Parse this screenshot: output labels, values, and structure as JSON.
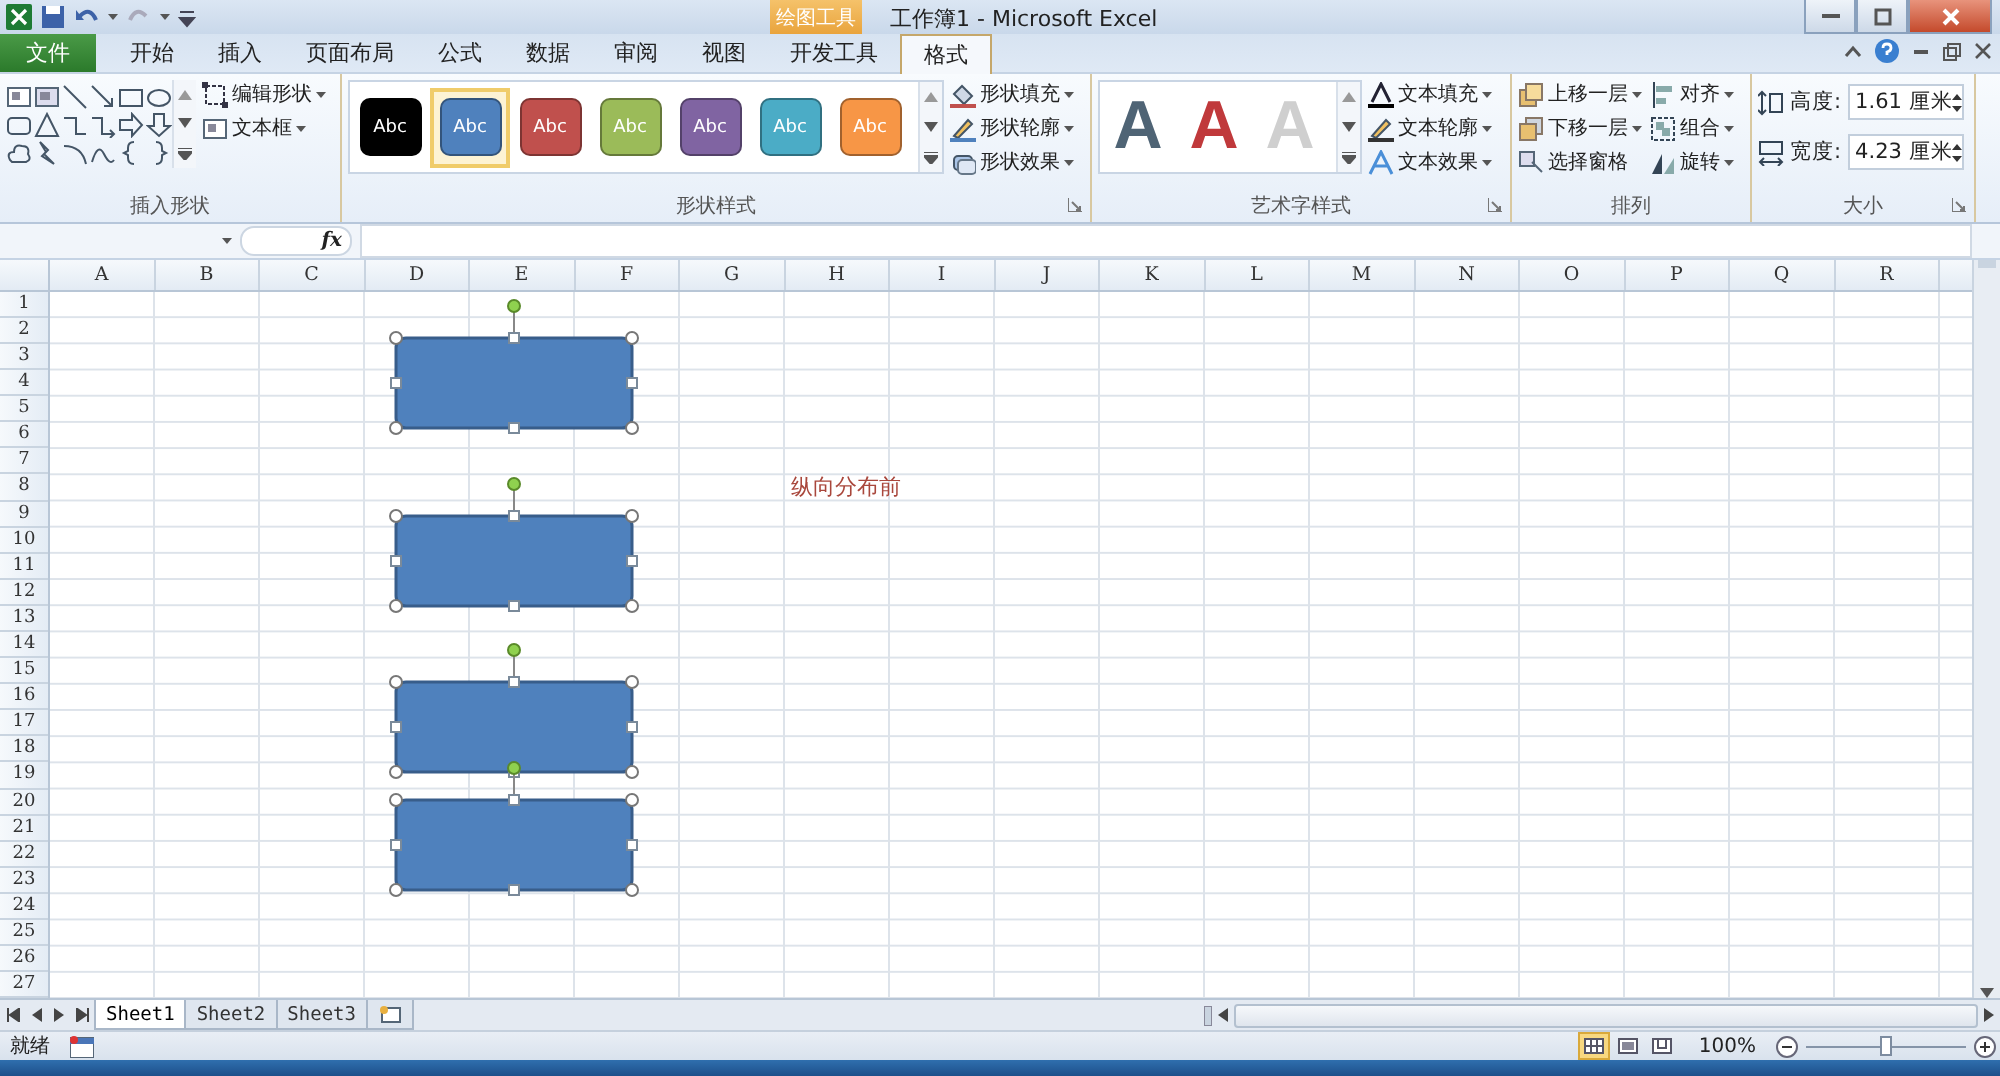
{
  "title_bar": {
    "context_tab": "绘图工具",
    "title": "工作簿1 - Microsoft Excel"
  },
  "menu_tabs": [
    {
      "label": "文件",
      "kind": "file",
      "selected": false
    },
    {
      "label": "开始",
      "kind": "tab",
      "selected": false
    },
    {
      "label": "插入",
      "kind": "tab",
      "selected": false
    },
    {
      "label": "页面布局",
      "kind": "tab",
      "selected": false
    },
    {
      "label": "公式",
      "kind": "tab",
      "selected": false
    },
    {
      "label": "数据",
      "kind": "tab",
      "selected": false
    },
    {
      "label": "审阅",
      "kind": "tab",
      "selected": false
    },
    {
      "label": "视图",
      "kind": "tab",
      "selected": false
    },
    {
      "label": "开发工具",
      "kind": "tab",
      "selected": false
    },
    {
      "label": "格式",
      "kind": "tab",
      "selected": true
    }
  ],
  "ribbon": {
    "insert_shapes": {
      "label": "插入形状",
      "commands": [
        {
          "label": "编辑形状",
          "dropdown": true
        },
        {
          "label": "文本框",
          "dropdown": true
        }
      ]
    },
    "shape_styles": {
      "label": "形状样式",
      "swatches": [
        {
          "text": "Abc",
          "color": "#000000",
          "selected": false
        },
        {
          "text": "Abc",
          "color": "#4f81bd",
          "selected": true
        },
        {
          "text": "Abc",
          "color": "#c0504d",
          "selected": false
        },
        {
          "text": "Abc",
          "color": "#9bbb59",
          "selected": false
        },
        {
          "text": "Abc",
          "color": "#8064a2",
          "selected": false
        },
        {
          "text": "Abc",
          "color": "#4bacc6",
          "selected": false
        },
        {
          "text": "Abc",
          "color": "#f79646",
          "selected": false
        }
      ],
      "commands": [
        {
          "label": "形状填充",
          "dropdown": true
        },
        {
          "label": "形状轮廓",
          "dropdown": true
        },
        {
          "label": "形状效果",
          "dropdown": true
        }
      ]
    },
    "wordart_styles": {
      "label": "艺术字样式",
      "styles": [
        {
          "text": "A",
          "color": "#4f6475"
        },
        {
          "text": "A",
          "color": "#c0393b"
        },
        {
          "text": "A",
          "color": "#cfcfcf"
        }
      ],
      "commands": [
        {
          "label": "文本填充",
          "dropdown": true
        },
        {
          "label": "文本轮廓",
          "dropdown": true
        },
        {
          "label": "文本效果",
          "dropdown": true
        }
      ]
    },
    "arrange": {
      "label": "排列",
      "commands": [
        {
          "label": "上移一层",
          "dropdown": true
        },
        {
          "label": "下移一层",
          "dropdown": true
        },
        {
          "label": "选择窗格",
          "dropdown": false
        },
        {
          "label": "对齐",
          "dropdown": true
        },
        {
          "label": "组合",
          "dropdown": true
        },
        {
          "label": "旋转",
          "dropdown": true
        }
      ]
    },
    "size": {
      "label": "大小",
      "fields": [
        {
          "label": "高度:",
          "value": "1.61 厘米"
        },
        {
          "label": "宽度:",
          "value": "4.23 厘米"
        }
      ]
    }
  },
  "formula_bar": {
    "function_label": "fx"
  },
  "columns": [
    "A",
    "B",
    "C",
    "D",
    "E",
    "F",
    "G",
    "H",
    "I",
    "J",
    "K",
    "L",
    "M",
    "N",
    "O",
    "P",
    "Q",
    "R"
  ],
  "rows": [
    "1",
    "2",
    "3",
    "4",
    "5",
    "6",
    "7",
    "8",
    "9",
    "10",
    "11",
    "12",
    "13",
    "14",
    "15",
    "16",
    "17",
    "18",
    "19",
    "20",
    "21",
    "22",
    "23",
    "24",
    "25",
    "26",
    "27"
  ],
  "cells": [
    {
      "text": "纵向分布前"
    }
  ],
  "shapes": [
    {
      "selected": true
    },
    {
      "selected": true
    },
    {
      "selected": true
    },
    {
      "selected": true
    }
  ],
  "sheet_tabs": [
    {
      "label": "Sheet1",
      "selected": true
    },
    {
      "label": "Sheet2",
      "selected": false
    },
    {
      "label": "Sheet3",
      "selected": false
    }
  ],
  "status_bar": {
    "status": "就绪",
    "zoom": "100%",
    "views": [
      {
        "selected": true
      },
      {
        "selected": false
      },
      {
        "selected": false
      }
    ],
    "zoom_slider": {
      "level": 0.5
    }
  }
}
